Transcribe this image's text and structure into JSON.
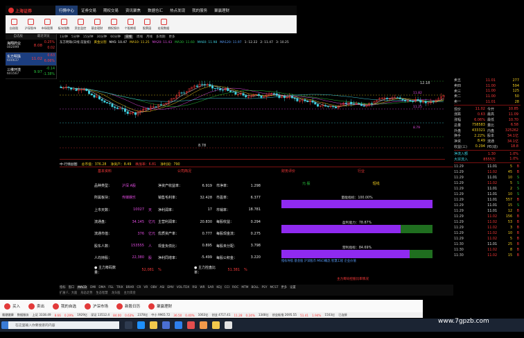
{
  "app": {
    "logo_text": "上海证券",
    "menus": [
      "行情中心",
      "证券交易",
      "期权交易",
      "资讯聚焦",
      "数据仓汇",
      "热点发现",
      "我的服务",
      "聚赢理财"
    ],
    "active_menu": "行情中心"
  },
  "toolbar": [
    "自选股",
    "沪深股市",
    "市场股票",
    "板块指数",
    "资金监控",
    "基金理财",
    "期权报价",
    "个股期权",
    "股票园",
    "宏观数据"
  ],
  "watchlist": {
    "tabs": [
      "自选股",
      "最近浏览"
    ],
    "items": [
      {
        "name": "海翔药业",
        "code": "002099",
        "price": "8.08",
        "pct": "0.25%",
        "chg": "0.02",
        "dir": "up"
      },
      {
        "name": "东方明珠",
        "code": "600637",
        "price": "11.02",
        "pct": "0.63",
        "pct2": "6.06%",
        "dir": "up"
      },
      {
        "name": "三维环境",
        "code": "601567",
        "price": "9.97",
        "pct": "-0.14",
        "pct2": "-1.38%",
        "dir": "down"
      }
    ]
  },
  "chart": {
    "period_tabs": [
      "1分钟",
      "5分钟",
      "15分钟",
      "30分钟",
      "60分钟",
      "日线",
      "周线",
      "月线",
      "多周期",
      "更多"
    ],
    "active_period": "日线",
    "ma_line": [
      "东方明珠(日线 前复权)",
      "黄金分割",
      "MA5: 10.47",
      "MA10: 11.25",
      "MA20: 11.43",
      "MA30: 11.60",
      "MA60: 11.98",
      "MA120: 11.97",
      "1: 12.22",
      "2: 11.47",
      "3: 10.25"
    ],
    "price_labels": [
      "11.82",
      "8.79",
      "11.25"
    ],
    "low_label": "8.78",
    "high_label": "12.18"
  },
  "info_bar": [
    "中·行情副图",
    "总市值：376.28",
    "净资产：8.49",
    "跌涨率：6.81",
    "净利润：790"
  ],
  "fund": {
    "col_heads": [
      "基本资料",
      "公司简况",
      "",
      "财务评价",
      "行业"
    ],
    "rows": [
      [
        "品种类型：",
        "沪深 A股",
        "净资产收益率：",
        "6.919",
        "市净率：",
        "1.298"
      ],
      [
        "所属板块：",
        "传媒娱乐",
        "销售毛利率：",
        "32.428",
        "市盈率：",
        "6.377"
      ],
      [
        "上市天数：",
        "10027",
        "天",
        "净利润率：",
        "17",
        "市销率：",
        "18.781"
      ],
      [
        "流通盘：",
        "34.145",
        "亿元",
        "主营利润率：",
        "20.830",
        "每股收益：",
        "0.294"
      ],
      [
        "流通市值：",
        "376",
        "亿元",
        "优质资产率：",
        "0.777",
        "每股现金流：",
        "0.275"
      ],
      [
        "股东人数：",
        "153555",
        "人",
        "现金负债比：",
        "0.895",
        "每股未分配：",
        "3.798"
      ],
      [
        "人均持股：",
        "22,380",
        "股",
        "净利同增率：",
        "-5.499",
        "每股公积金：",
        "3.220"
      ],
      [
        "● 主力筹码数量：",
        "52,081",
        "%",
        "● 主力控盘比率：",
        "51.381",
        "%"
      ]
    ],
    "bar_heads": [
      "元·股",
      "短线"
    ],
    "bars": [
      {
        "label": "量能指标：100.00%",
        "pct": 1.0
      },
      {
        "label": "盈利能力：78.87%",
        "pct": 0.7887
      },
      {
        "label": "营利指标：84.69%",
        "pct": 0.8469
      }
    ],
    "tag_line": "指标导航 基金股 沪深股市 MSCI概念 智慧工程 企业价值",
    "footer_note": "主力筹码控股比率情况"
  },
  "bottom_tabs": [
    "指标",
    "窗口",
    "MACD",
    "DMI",
    "DMA",
    "FSL",
    "TRIX",
    "BRAR",
    "CR",
    "VR",
    "OBV",
    "ASI",
    "EMV",
    "VOL-TDX",
    "RSI",
    "WR",
    "SAR",
    "KDJ",
    "CCI",
    "ROC",
    "MTM",
    "BOLL",
    "PSY",
    "MCST",
    "更多",
    "设置"
  ],
  "bottom_tabs2": [
    "扩展 F、大面",
    "形态走势",
    "生态智慧",
    "龙头股",
    "主力资金"
  ],
  "quote": {
    "sell": [
      {
        "n": "卖五",
        "p": "11.01",
        "v": "277"
      },
      {
        "n": "卖四",
        "p": "11.00",
        "v": "594"
      },
      {
        "n": "卖三",
        "p": "11.00",
        "v": "125"
      },
      {
        "n": "卖二",
        "p": "11.00",
        "v": "50"
      },
      {
        "n": "卖一",
        "p": "11.01",
        "v": "28"
      }
    ],
    "stats": [
      [
        "现价",
        "11.02",
        "今开",
        "10.85"
      ],
      [
        "涨跌",
        "0.63",
        "最高",
        "11.09"
      ],
      [
        "涨幅",
        "6.06%",
        "最低",
        "10.70"
      ],
      [
        "总量",
        "758583",
        "量比",
        "6.58"
      ],
      [
        "外盘",
        "433321",
        "内盘",
        "325262"
      ],
      [
        "换手",
        "2.22%",
        "股本",
        "34.1亿"
      ],
      [
        "净资",
        "8.49",
        "流通",
        "34.1亿"
      ],
      [
        "收益(三)",
        "0.294",
        "PE(动)",
        "18.8"
      ]
    ],
    "flows": [
      [
        "净流入额",
        "1.30",
        "1.0%"
      ],
      [
        "大宗流入",
        "8555万",
        "1.0%"
      ]
    ],
    "ticks": [
      [
        "11:29",
        "11.01",
        "5",
        "B"
      ],
      [
        "11:29",
        "11.02",
        "45",
        "B"
      ],
      [
        "11:29",
        "11.01",
        "10",
        "S"
      ],
      [
        "11:29",
        "11.02",
        "5",
        "S"
      ],
      [
        "11:29",
        "11.01",
        "2",
        "S"
      ],
      [
        "11:29",
        "11.01",
        "10",
        "S"
      ],
      [
        "11:29",
        "11.01",
        "557",
        "B"
      ],
      [
        "11:29",
        "11.01",
        "15",
        "S"
      ],
      [
        "11:29",
        "11.01",
        "12",
        "B"
      ],
      [
        "11:29",
        "11.02",
        "156",
        "B"
      ],
      [
        "11:29",
        "11.02",
        "53",
        "B"
      ],
      [
        "11:29",
        "11.02",
        "3",
        "B"
      ],
      [
        "11:29",
        "11.02",
        "10",
        "B"
      ],
      [
        "11:29",
        "11.02",
        "5",
        "B"
      ],
      [
        "11:30",
        "11.01",
        "25",
        "B"
      ],
      [
        "11:30",
        "11.02",
        "8",
        "B"
      ],
      [
        "11:30",
        "11.02",
        "15",
        "B"
      ]
    ]
  },
  "trade_bar": [
    "买入",
    "卖出",
    "我的自选",
    "沪深市场",
    "新股日历",
    "聚赢理财"
  ],
  "index_strip": [
    "隆健健康",
    "数据服务",
    "上证 3338.49",
    "8.66",
    "0.29%",
    "1929亿",
    "深证 13512.4",
    "84.00",
    "0.63%",
    "2378亿",
    "中小 9965.72",
    "36.50",
    "0.40%",
    "1063亿",
    "创业 4717.41",
    "11.28",
    "0.24%",
    "1348亿",
    "创业板指 2695.55",
    "51.41",
    "1.94%",
    "1503亿",
    "已连接"
  ],
  "taskbar": {
    "search_placeholder": "在这里输入你要搜索的内容"
  },
  "brand": "www.7gpzb.com",
  "colors": {
    "up": "#ff3b3b",
    "down": "#29c23d",
    "accent": "#1d3b6e",
    "purple": "#8f2af0"
  }
}
